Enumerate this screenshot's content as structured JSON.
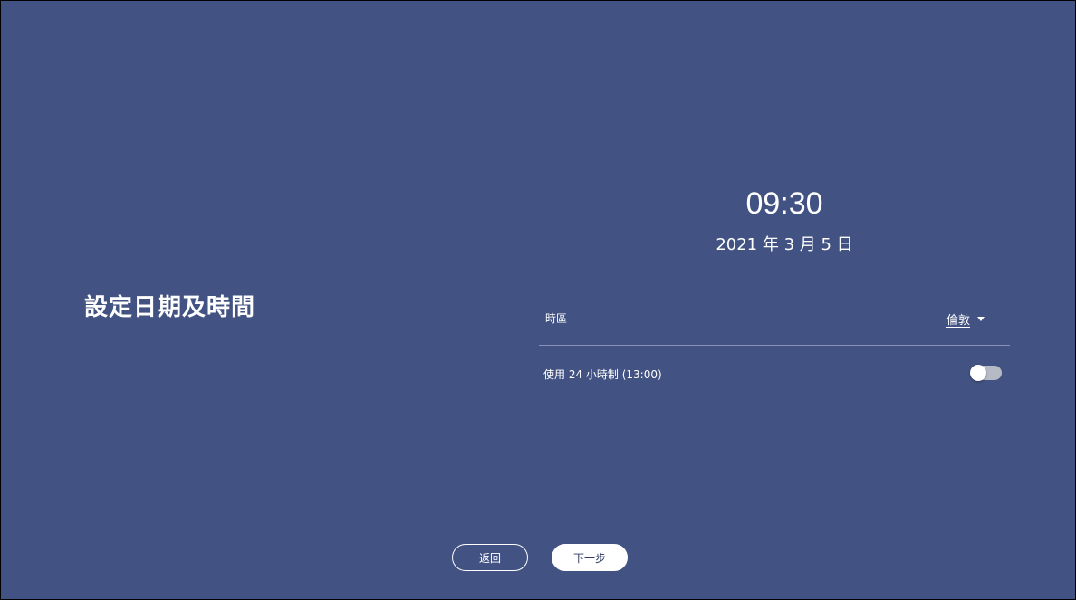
{
  "page": {
    "title": "設定日期及時間",
    "background_color": "#425282"
  },
  "clock": {
    "time": "09:30",
    "date": "2021 年 3 月 5 日"
  },
  "timezone": {
    "label": "時區",
    "selected": "倫敦",
    "icon": "caret-down-icon"
  },
  "hour24": {
    "label": "使用 24 小時制 (13:00)",
    "enabled": false
  },
  "buttons": {
    "back_label": "返回",
    "next_label": "下一步"
  }
}
